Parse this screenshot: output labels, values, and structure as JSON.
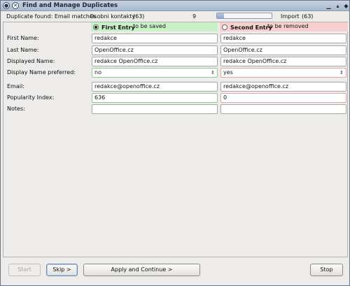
{
  "window": {
    "title": "Find and Manage Duplicates"
  },
  "info": {
    "found": "Duplicate found: Email matches",
    "addressbook": "Osobni kontakty",
    "addressbook_count": "(63)",
    "current": "9",
    "progress": 0.13,
    "import_label": "Import",
    "import_count": "(63)"
  },
  "entries": {
    "first": {
      "label": "First Entry",
      "note": "to be saved",
      "selected": true
    },
    "second": {
      "label": "Second Entry",
      "note": "to be removed",
      "selected": false
    }
  },
  "fields": [
    {
      "label": "First Name:",
      "left": "redakce",
      "right": "redakce"
    },
    {
      "label": "Last Name:",
      "left": "OpenOffice.cz",
      "right": "OpenOffice.cz"
    },
    {
      "label": "Displayed Name:",
      "left": "redakce OpenOffice.cz",
      "right": "redakce OpenOffice.cz"
    },
    {
      "label": "Display Name preferred:",
      "left": "no",
      "right": "yes"
    },
    {
      "label": "Email:",
      "left": "redakce@openoffice.cz",
      "right": "redakce@openoffice.cz"
    },
    {
      "label": "Popularity Index:",
      "left": "636",
      "right": "0"
    },
    {
      "label": "Notes:",
      "left": "",
      "right": ""
    }
  ],
  "buttons": {
    "start": "Start",
    "skip": "Skip >",
    "apply": "Apply and Continue >",
    "stop": "Stop"
  },
  "colors": {
    "first_entry_bg": "#c8f1c8",
    "second_entry_bg": "#f8cfcf"
  }
}
